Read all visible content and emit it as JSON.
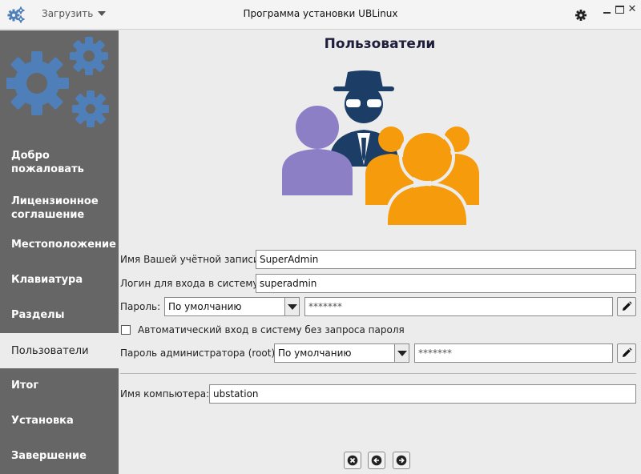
{
  "titlebar": {
    "menu_label": "Загрузить",
    "title": "Программа установки UBLinux"
  },
  "sidebar": {
    "items": [
      {
        "label": "Добро пожаловать",
        "active": false
      },
      {
        "label": "Лицензионное соглашение",
        "active": false
      },
      {
        "label": "Местоположение",
        "active": false
      },
      {
        "label": "Клавиатура",
        "active": false
      },
      {
        "label": "Разделы",
        "active": false
      },
      {
        "label": "Пользователи",
        "active": true
      },
      {
        "label": "Итог",
        "active": false
      },
      {
        "label": "Установка",
        "active": false
      },
      {
        "label": "Завершение",
        "active": false
      }
    ]
  },
  "page": {
    "title": "Пользователи"
  },
  "form": {
    "account_label": "Имя Вашей учётной записи:",
    "account_value": "SuperAdmin",
    "login_label": "Логин для входа в систему:",
    "login_value": "superadmin",
    "password_label": "Пароль:",
    "password_mode": "По умолчанию",
    "password_value": "*******",
    "autologin_label": "Автоматический вход в систему без запроса пароля",
    "autologin_checked": false,
    "root_label": "Пароль администратора (root):",
    "root_mode": "По умолчанию",
    "root_value": "*******",
    "hostname_label": "Имя компьютера:",
    "hostname_value": "ubstation"
  },
  "colors": {
    "sidebar_bg": "#666666",
    "gear_blue": "#4f7fb8",
    "user_purple": "#8c7fc6",
    "user_orange": "#f59b0c",
    "spy_navy": "#1c3d66"
  },
  "icons": {
    "app": "gears-icon",
    "settings": "gear-icon",
    "edit": "pencil-icon",
    "cancel": "cancel-icon",
    "back": "arrow-left-icon",
    "next": "arrow-right-icon"
  }
}
